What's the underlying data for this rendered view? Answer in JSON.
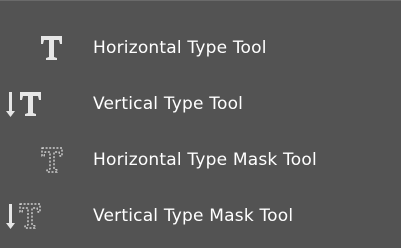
{
  "menu": {
    "items": [
      {
        "label": "Horizontal Type Tool",
        "icon": "horizontal-type-icon"
      },
      {
        "label": "Vertical Type Tool",
        "icon": "vertical-type-icon"
      },
      {
        "label": "Horizontal Type Mask Tool",
        "icon": "horizontal-type-mask-icon"
      },
      {
        "label": "Vertical Type Mask Tool",
        "icon": "vertical-type-mask-icon"
      }
    ]
  },
  "colors": {
    "background": "#535353",
    "text": "#ffffff",
    "icon": "#e6e6e6"
  }
}
